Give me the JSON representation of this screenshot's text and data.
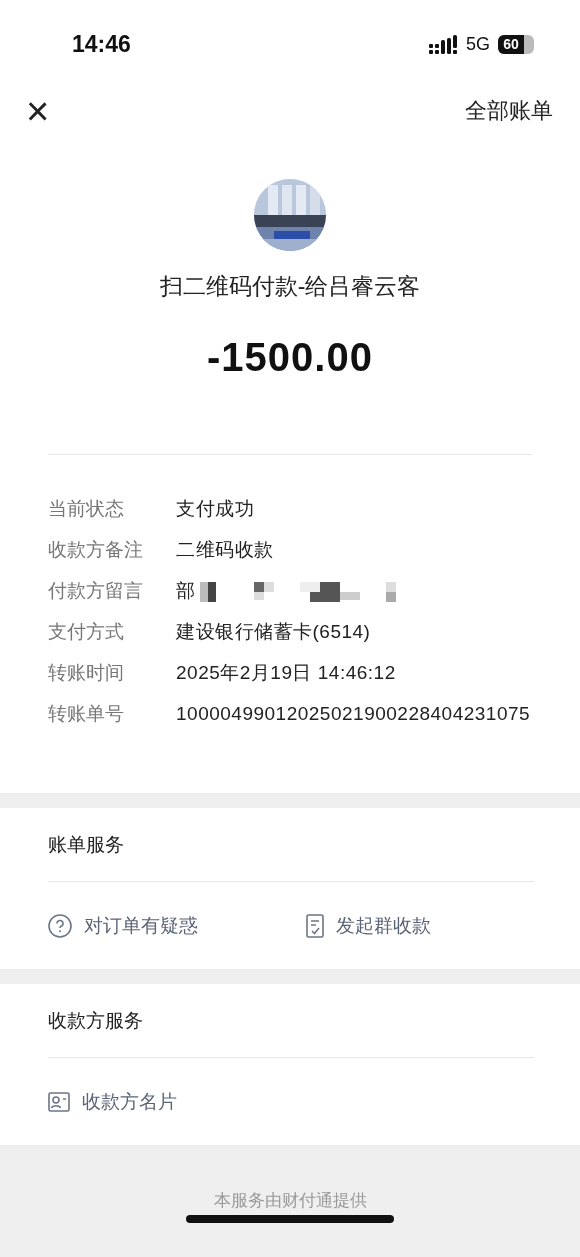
{
  "status_bar": {
    "time": "14:46",
    "network": "5G",
    "battery": "60"
  },
  "nav": {
    "close": "×",
    "all_bills": "全部账单"
  },
  "header": {
    "title": "扫二维码付款-给吕睿云客",
    "amount": "-1500.00"
  },
  "details": [
    {
      "label": "当前状态",
      "value": "支付成功",
      "redacted": false
    },
    {
      "label": "收款方备注",
      "value": "二维码收款",
      "redacted": false
    },
    {
      "label": "付款方留言",
      "value": "部",
      "redacted": true
    },
    {
      "label": "支付方式",
      "value": "建设银行储蓄卡(6514)",
      "redacted": false
    },
    {
      "label": "转账时间",
      "value": "2025年2月19日 14:46:12",
      "redacted": false
    },
    {
      "label": "转账单号",
      "value": "10000499012025021900228404231075",
      "redacted": false
    }
  ],
  "sections": [
    {
      "title": "账单服务",
      "actions": [
        {
          "kind": "inquiry",
          "label": "对订单有疑惑"
        },
        {
          "kind": "group-collect",
          "label": "发起群收款"
        }
      ]
    },
    {
      "title": "收款方服务",
      "actions": [
        {
          "kind": "merchant-card",
          "label": "收款方名片"
        }
      ]
    }
  ],
  "footer": {
    "text": "本服务由财付通提供"
  }
}
